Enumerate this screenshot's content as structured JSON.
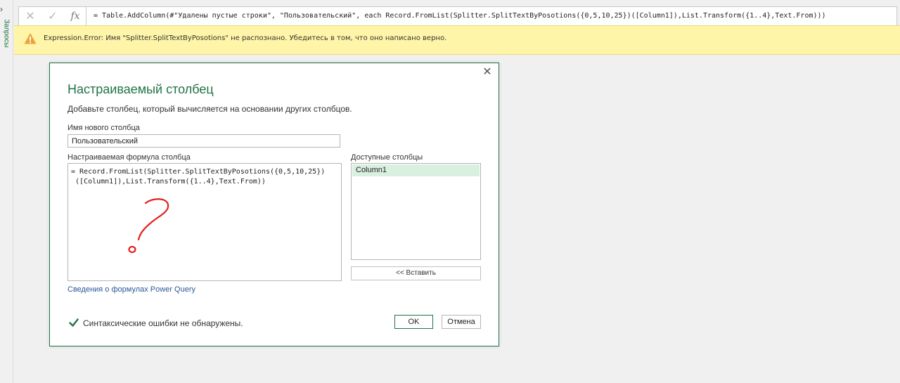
{
  "sidebar": {
    "expand_glyph": "›",
    "label": "Запросы"
  },
  "formula_bar": {
    "cancel_glyph": "✕",
    "confirm_glyph": "✓",
    "fx_label": "fx",
    "formula": "= Table.AddColumn(#\"Удалены пустые строки\", \"Пользовательский\", each Record.FromList(Splitter.SplitTextByPosotions({0,5,10,25})([Column1]),List.Transform({1..4},Text.From)))"
  },
  "error_bar": {
    "icon": "warning-triangle-icon",
    "message": "Expression.Error: Имя \"Splitter.SplitTextByPosotions\" не распознано. Убедитесь в том, что оно написано верно."
  },
  "dialog": {
    "close_glyph": "✕",
    "title": "Настраиваемый столбец",
    "subtitle": "Добавьте столбец, который вычисляется на основании других столбцов.",
    "new_column_label": "Имя нового столбца",
    "new_column_value": "Пользовательский",
    "formula_label": "Настраиваемая формула столбца",
    "formula_text": "= Record.FromList(Splitter.SplitTextByPosotions({0,5,10,25})\n ([Column1]),List.Transform({1..4},Text.From))",
    "available_columns_label": "Доступные столбцы",
    "available_columns": [
      "Column1"
    ],
    "insert_button": "<< Вставить",
    "help_link": "Сведения о формулах Power Query",
    "status": "Синтаксические ошибки не обнаружены.",
    "ok_button": "OK",
    "cancel_button": "Отмена"
  },
  "colors": {
    "accent": "#217346",
    "error_background": "#fff5a8",
    "selected_item": "#d9efe0",
    "annotation": "#e0201b"
  }
}
